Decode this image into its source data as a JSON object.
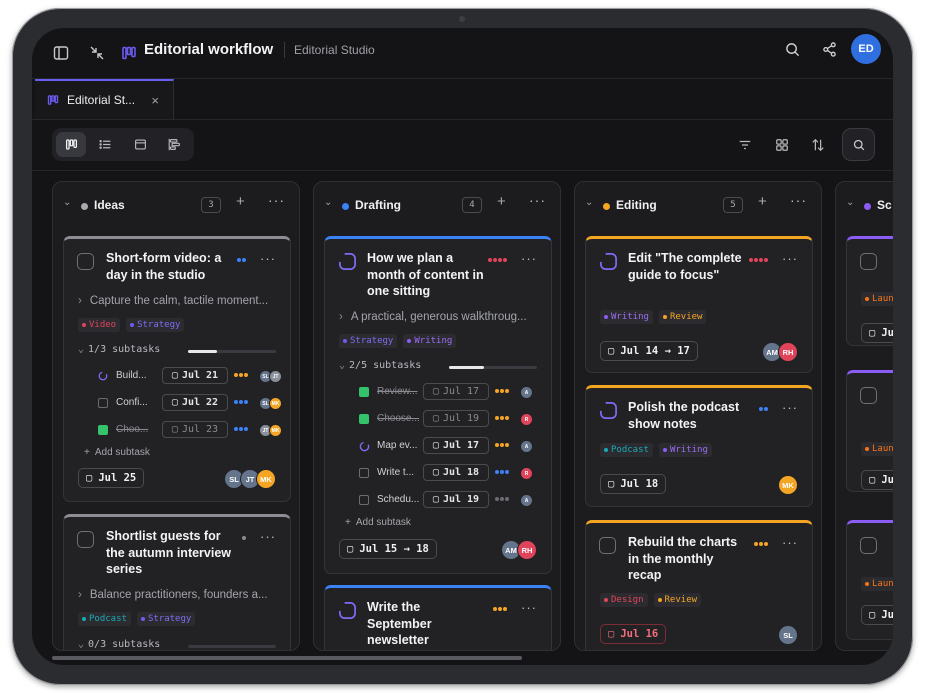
{
  "app": {
    "title": "Editorial workflow",
    "workspace": "Editorial Studio",
    "user_initials": "ED",
    "accent": "#6a5cf0"
  },
  "tab": {
    "label": "Editorial St...",
    "close": "×"
  },
  "toolbar": {
    "views": [
      "board-view-icon",
      "list-view-icon",
      "calendar-view-icon",
      "timeline-view-icon"
    ],
    "active_view": "board"
  },
  "columns": [
    {
      "name": "Ideas",
      "count": "3",
      "color": "#a9aab0",
      "cards": [
        {
          "title": "Short-form video: a day in the studio",
          "description": "Capture the calm, tactile moment...",
          "tags": [
            {
              "label": "Video",
              "color": "#e0445a"
            },
            {
              "label": "Strategy",
              "color": "#6d5cf0"
            }
          ],
          "subtasks_label": "1/3 subtasks",
          "subtasks_done_fraction": 0.33,
          "subtasks": [
            {
              "title": "Build...",
              "date": "Jul 21",
              "avatars": [
                "SL",
                "JT"
              ]
            },
            {
              "title": "Confi...",
              "date": "Jul 22",
              "avatars": [
                "SL",
                "MK"
              ]
            },
            {
              "title": "Choo...",
              "date": "Jul 23",
              "avatars": [
                "JT",
                "MK"
              ]
            }
          ],
          "add_subtask": "Add subtask",
          "due": "Jul 25",
          "avatars": [
            "SL",
            "JT",
            "MK"
          ]
        },
        {
          "title": "Shortlist guests for the autumn interview series",
          "description": "Balance practitioners, founders a...",
          "tags": [
            {
              "label": "Podcast",
              "color": "#19a9b5"
            },
            {
              "label": "Strategy",
              "color": "#6d5cf0"
            }
          ],
          "subtasks_label": "0/3 subtasks",
          "subtasks_done_fraction": 0
        }
      ]
    },
    {
      "name": "Drafting",
      "count": "4",
      "color": "#3b82f6",
      "cards": [
        {
          "title": "How we plan a month of content in one sitting",
          "description": "A practical, generous walkthroug...",
          "tags": [
            {
              "label": "Strategy",
              "color": "#6d5cf0"
            },
            {
              "label": "Writing",
              "color": "#8b5cf6"
            }
          ],
          "subtasks_label": "2/5 subtasks",
          "subtasks_done_fraction": 0.4,
          "subtasks": [
            {
              "title": "Review...",
              "date": "Jul 17",
              "avatars": [
                "A"
              ]
            },
            {
              "title": "Choose...",
              "date": "Jul 19",
              "avatars": [
                "R"
              ]
            },
            {
              "title": "Map ev...",
              "date": "Jul 17",
              "avatars": [
                "A"
              ]
            },
            {
              "title": "Write t...",
              "date": "Jul 18",
              "avatars": [
                "R"
              ]
            },
            {
              "title": "Schedu...",
              "date": "Jul 19",
              "avatars": [
                "A"
              ]
            }
          ],
          "add_subtask": "Add subtask",
          "due": "Jul 15 → 18",
          "avatars": [
            "AM",
            "RH"
          ]
        },
        {
          "title": "Write the September newsletter"
        }
      ]
    },
    {
      "name": "Editing",
      "count": "5",
      "color": "#f5a524",
      "cards": [
        {
          "title": "Edit \"The complete guide to focus\"",
          "tags": [
            {
              "label": "Writing",
              "color": "#8b5cf6"
            },
            {
              "label": "Review",
              "color": "#f5a524"
            }
          ],
          "due": "Jul 14 → 17",
          "avatars": [
            "AM",
            "RH"
          ]
        },
        {
          "title": "Polish the podcast show notes",
          "tags": [
            {
              "label": "Podcast",
              "color": "#19a9b5"
            },
            {
              "label": "Writing",
              "color": "#8b5cf6"
            }
          ],
          "due": "Jul 18",
          "avatars": [
            "MK"
          ]
        },
        {
          "title": "Rebuild the charts in the monthly recap",
          "tags": [
            {
              "label": "Design",
              "color": "#e0445a"
            },
            {
              "label": "Review",
              "color": "#f5a524"
            }
          ],
          "due": "Jul 16",
          "avatars": [
            "SL"
          ]
        }
      ]
    },
    {
      "name": "Sc",
      "color": "#8b5cf6",
      "cards": [
        {
          "tag": "Laun",
          "due": "Ju"
        },
        {
          "tag": "Laun",
          "due": "Ju"
        },
        {
          "tag": "Laun",
          "due": "Ju"
        }
      ]
    }
  ]
}
